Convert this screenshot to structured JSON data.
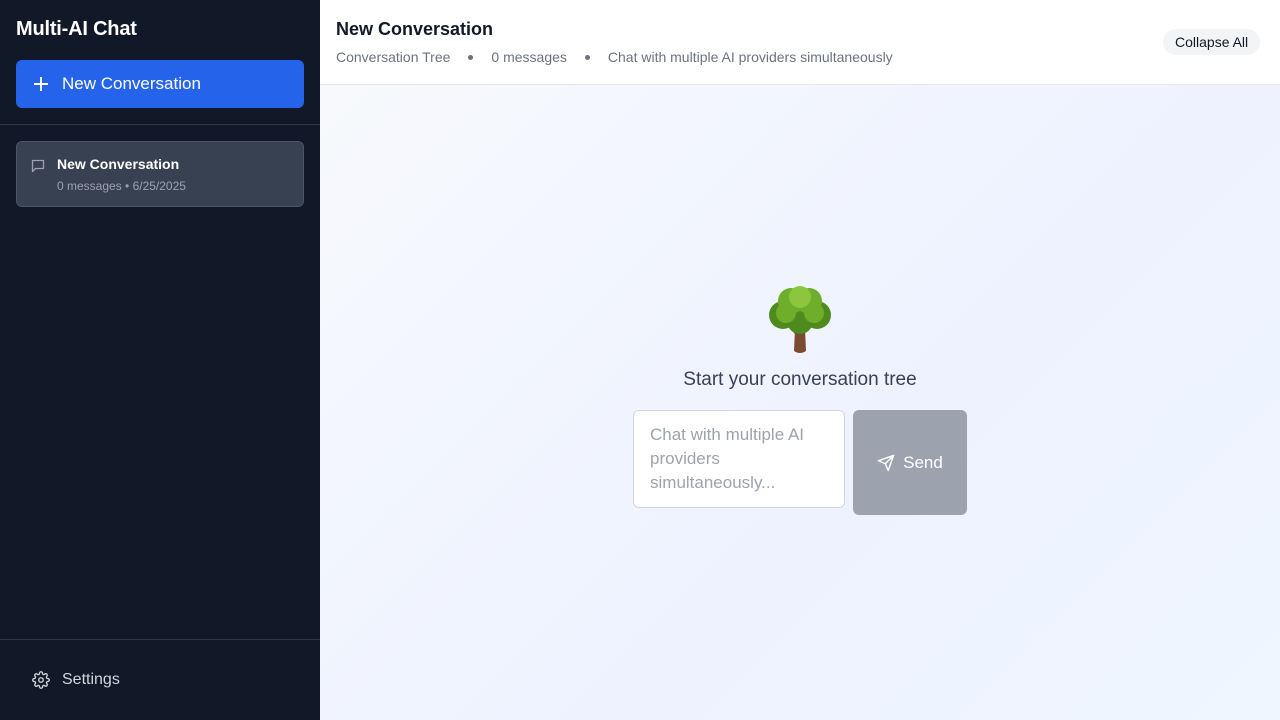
{
  "app": {
    "title": "Multi-AI Chat"
  },
  "sidebar": {
    "new_conversation_label": "New Conversation",
    "conversations": [
      {
        "title": "New Conversation",
        "meta": "0 messages • 6/25/2025"
      }
    ],
    "settings_label": "Settings",
    "colors": {
      "background": "#111827",
      "accent": "#2563eb",
      "item_bg": "#374151"
    }
  },
  "header": {
    "title": "New Conversation",
    "view_label": "Conversation Tree",
    "message_count": "0 messages",
    "tagline": "Chat with multiple AI providers simultaneously",
    "collapse_label": "Collapse All"
  },
  "main": {
    "empty_heading": "Start your conversation tree",
    "input_placeholder": "Chat with multiple AI providers simultaneously...",
    "input_value": "",
    "send_label": "Send",
    "send_state": "disabled"
  },
  "icons": [
    "plus-icon",
    "chat-bubble-icon",
    "gear-icon",
    "tree-icon",
    "send-icon"
  ]
}
